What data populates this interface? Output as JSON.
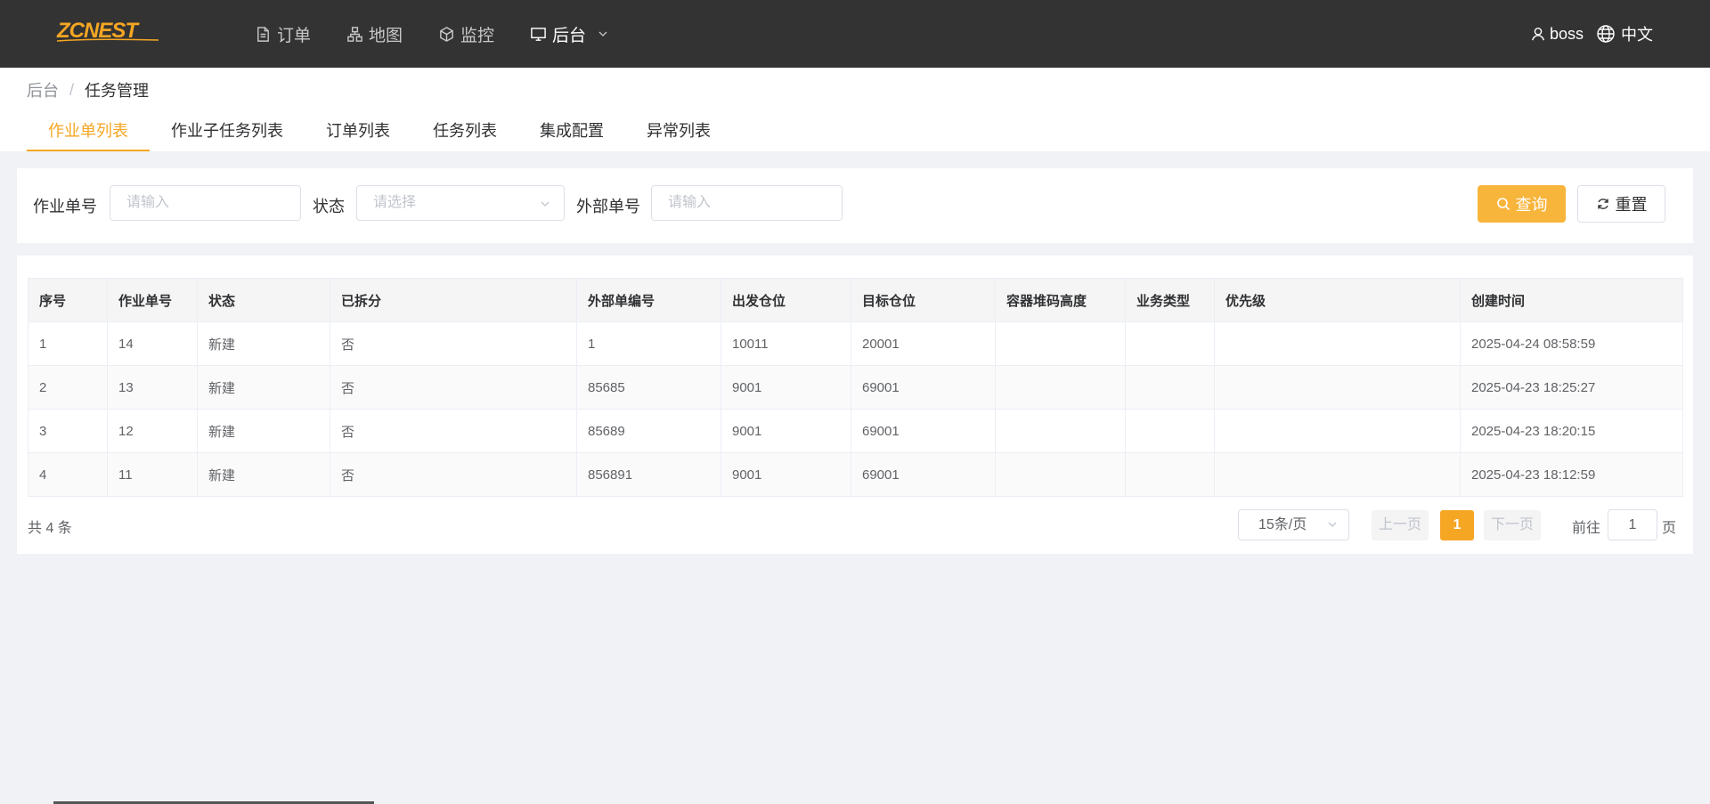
{
  "header": {
    "logo_text": "ZCNEST",
    "nav": [
      {
        "label": "订单",
        "icon": "document-icon"
      },
      {
        "label": "地图",
        "icon": "sitemap-icon"
      },
      {
        "label": "监控",
        "icon": "cube-icon"
      },
      {
        "label": "后台",
        "icon": "monitor-icon"
      }
    ],
    "user": "boss",
    "language": "中文"
  },
  "breadcrumb": {
    "root": "后台",
    "separator": "/",
    "current": "任务管理"
  },
  "tabs": [
    "作业单列表",
    "作业子任务列表",
    "订单列表",
    "任务列表",
    "集成配置",
    "异常列表"
  ],
  "filter": {
    "job_no_label": "作业单号",
    "job_no_placeholder": "请输入",
    "status_label": "状态",
    "status_placeholder": "请选择",
    "ext_no_label": "外部单号",
    "ext_no_placeholder": "请输入",
    "query_label": "查询",
    "reset_label": "重置"
  },
  "table": {
    "columns": [
      "序号",
      "作业单号",
      "状态",
      "已拆分",
      "外部单编号",
      "出发仓位",
      "目标仓位",
      "容器堆码高度",
      "业务类型",
      "优先级",
      "创建时间"
    ],
    "rows": [
      [
        "1",
        "14",
        "新建",
        "否",
        "1",
        "10011",
        "20001",
        "",
        "",
        "",
        "2025-04-24 08:58:59"
      ],
      [
        "2",
        "13",
        "新建",
        "否",
        "85685",
        "9001",
        "69001",
        "",
        "",
        "",
        "2025-04-23 18:25:27"
      ],
      [
        "3",
        "12",
        "新建",
        "否",
        "85689",
        "9001",
        "69001",
        "",
        "",
        "",
        "2025-04-23 18:20:15"
      ],
      [
        "4",
        "11",
        "新建",
        "否",
        "856891",
        "9001",
        "69001",
        "",
        "",
        "",
        "2025-04-23 18:12:59"
      ]
    ]
  },
  "pagination": {
    "total": "共 4 条",
    "page_size": "15条/页",
    "prev": "上一页",
    "current": "1",
    "next": "下一页",
    "goto_prefix": "前往",
    "goto_value": "1",
    "goto_suffix": "页"
  },
  "colors": {
    "accent": "#f5a623",
    "topbar": "#333333"
  }
}
